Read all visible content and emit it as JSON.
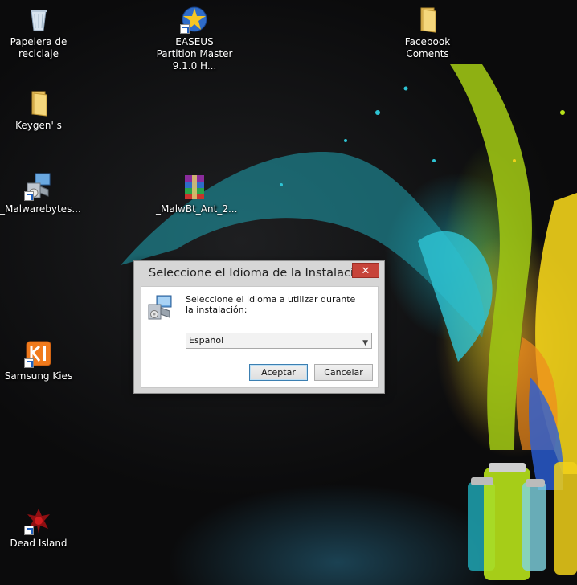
{
  "desktop": {
    "icons": [
      {
        "id": "recycle-bin",
        "label": "Papelera de reciclaje",
        "icon": "recycle-bin-icon"
      },
      {
        "id": "easeus",
        "label": "EASEUS Partition Master 9.1.0 H...",
        "icon": "easeus-icon"
      },
      {
        "id": "facebook-coments",
        "label": "Facebook Coments",
        "icon": "folder-icon"
      },
      {
        "id": "keygens",
        "label": "Keygen' s",
        "icon": "folder-icon"
      },
      {
        "id": "malwarebytes-setup",
        "label": "_Malwarebytes...",
        "icon": "installer-icon"
      },
      {
        "id": "malwbt-archive",
        "label": "_MalwBt_Ant_2...",
        "icon": "winrar-icon"
      },
      {
        "id": "samsung-kies",
        "label": "Samsung Kies",
        "icon": "kies-icon"
      },
      {
        "id": "dead-island",
        "label": "Dead Island",
        "icon": "dead-island-icon"
      }
    ]
  },
  "dialog": {
    "title": "Seleccione el Idioma de la Instalación",
    "close_label": "✕",
    "prompt": "Seleccione el idioma a utilizar durante la instalación:",
    "language_selected": "Español",
    "ok_label": "Aceptar",
    "cancel_label": "Cancelar"
  },
  "colors": {
    "close_button": "#c7443a",
    "default_button_border": "#3c7fb1",
    "dialog_frame": "#d6d6d6"
  }
}
